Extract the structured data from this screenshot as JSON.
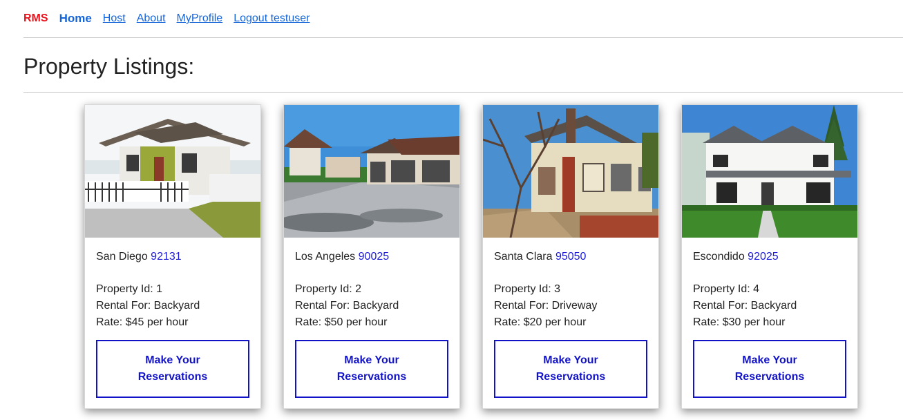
{
  "nav": {
    "brand": "RMS",
    "home": "Home",
    "links": [
      "Host",
      "About",
      "MyProfile",
      "Logout testuser"
    ]
  },
  "page_title": "Property Listings:",
  "labels": {
    "property_id": "Property Id:",
    "rental_for": "Rental For:",
    "rate": "Rate:",
    "button": "Make Your Reservations"
  },
  "listings": [
    {
      "city": "San Diego",
      "zip": "92131",
      "id_text": "Property Id: 1",
      "rental_text": "Rental For: Backyard",
      "rate_text": "Rate: $45 per hour",
      "button": "Make Your Reservations"
    },
    {
      "city": "Los Angeles",
      "zip": "90025",
      "id_text": "Property Id: 2",
      "rental_text": "Rental For: Backyard",
      "rate_text": "Rate: $50 per hour",
      "button": "Make Your Reservations"
    },
    {
      "city": "Santa Clara",
      "zip": "95050",
      "id_text": "Property Id: 3",
      "rental_text": "Rental For: Driveway",
      "rate_text": "Rate: $20 per hour",
      "button": "Make Your Reservations"
    },
    {
      "city": "Escondido",
      "zip": "92025",
      "id_text": "Property Id: 4",
      "rental_text": "Rental For: Backyard",
      "rate_text": "Rate: $30 per hour",
      "button": "Make Your Reservations"
    }
  ],
  "colors": {
    "brand": "#e8101a",
    "link": "#1565d8",
    "zip": "#1a1ad6",
    "button": "#1212c8"
  }
}
